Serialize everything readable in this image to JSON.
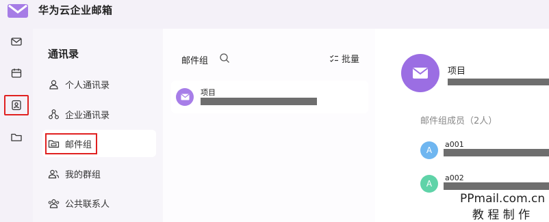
{
  "app": {
    "title": "华为云企业邮箱",
    "logo_icon": "mail-logo-icon"
  },
  "rail": [
    {
      "name": "mail",
      "icon": "mail-icon"
    },
    {
      "name": "calendar",
      "icon": "calendar-icon"
    },
    {
      "name": "contacts",
      "icon": "contacts-icon",
      "active": true
    },
    {
      "name": "folder",
      "icon": "folder-icon"
    }
  ],
  "nav": {
    "heading": "通讯录",
    "items": [
      {
        "label": "个人通讯录",
        "icon": "person-icon"
      },
      {
        "label": "企业通讯录",
        "icon": "org-icon"
      },
      {
        "label": "邮件组",
        "icon": "folder-group-icon",
        "active": true
      },
      {
        "label": "我的群组",
        "icon": "group-icon"
      },
      {
        "label": "公共联系人",
        "icon": "public-contacts-icon"
      }
    ]
  },
  "list": {
    "title": "邮件组",
    "batch_label": "批量",
    "rows": [
      {
        "name": "项目"
      }
    ]
  },
  "detail": {
    "name": "项目",
    "members_title": "邮件组成员（2人）",
    "members": [
      {
        "initial": "A",
        "name": "a001",
        "color": "#6fb6f0"
      },
      {
        "initial": "A",
        "name": "a002",
        "color": "#5fd3a8"
      }
    ]
  },
  "colors": {
    "accent": "#9b6ee3",
    "highlight_border": "#e02020"
  },
  "watermark": {
    "line1": "PPmail.com.cn",
    "line2": "教 程 制 作"
  }
}
